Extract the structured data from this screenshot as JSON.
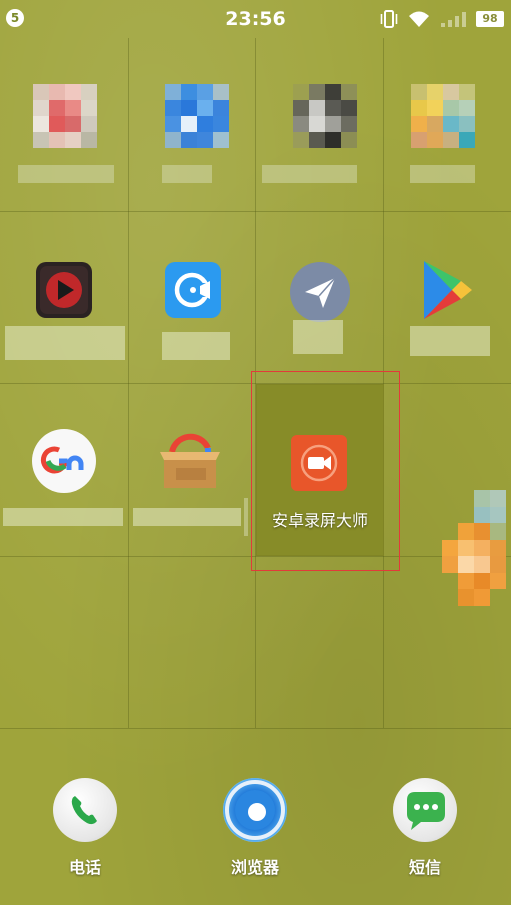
{
  "status_bar": {
    "notification_count": "5",
    "time": "23:56",
    "battery_level": "98",
    "icons": [
      "vibrate-icon",
      "wifi-icon",
      "signal-icon",
      "battery-icon"
    ]
  },
  "apps": {
    "screen_recorder_label": "安卓录屏大师"
  },
  "dock": {
    "phone_label": "电话",
    "browser_label": "浏览器",
    "sms_label": "短信"
  },
  "colors": {
    "wallpaper": "#9fa43b",
    "highlight_cell": "#878c28",
    "highlight_border": "#e23a3a",
    "recorder_icon": "#e8562a"
  }
}
